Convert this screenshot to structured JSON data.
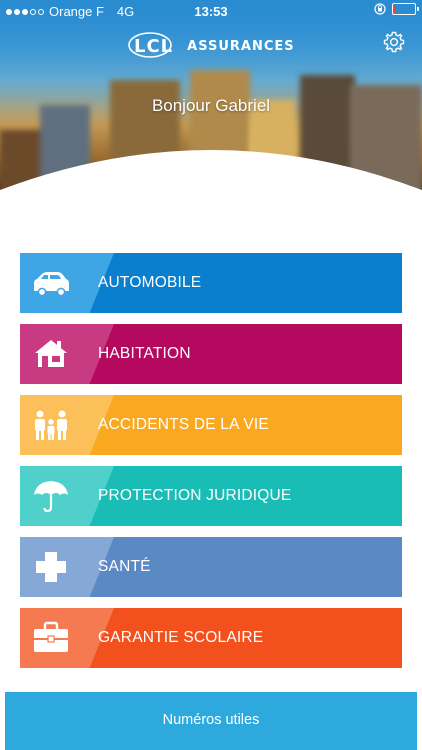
{
  "status_bar": {
    "carrier": "Orange F",
    "network": "4G",
    "time": "13:53",
    "battery_level": 0.12
  },
  "header": {
    "logo_mark": "LCL",
    "logo_text": "ASSURANCES",
    "settings_icon": "gear-icon",
    "greeting": "Bonjour Gabriel"
  },
  "menu": {
    "items": [
      {
        "label": "AUTOMOBILE",
        "icon": "car-icon",
        "color": "#0a7fcd",
        "icon_bg": "#3fa6e6"
      },
      {
        "label": "HABITATION",
        "icon": "house-icon",
        "color": "#b5095f",
        "icon_bg": "#c83a82"
      },
      {
        "label": "ACCIDENTS DE LA VIE",
        "icon": "family-icon",
        "color": "#f9a820",
        "icon_bg": "#fbc05a"
      },
      {
        "label": "PROTECTION JURIDIQUE",
        "icon": "umbrella-icon",
        "color": "#19bdb5",
        "icon_bg": "#4fd0ca"
      },
      {
        "label": "SANTÉ",
        "icon": "cross-icon",
        "color": "#5b89c3",
        "icon_bg": "#86a8d6"
      },
      {
        "label": "GARANTIE SCOLAIRE",
        "icon": "briefcase-icon",
        "color": "#f2511e",
        "icon_bg": "#f57a52"
      }
    ]
  },
  "footer": {
    "button_label": "Numéros utiles",
    "color": "#2ea9de"
  }
}
